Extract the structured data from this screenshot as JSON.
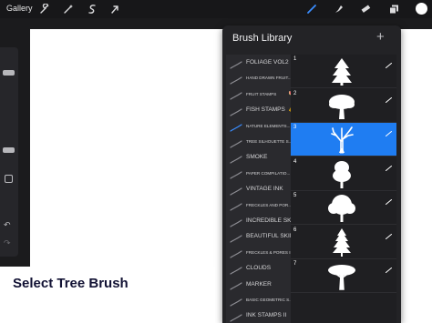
{
  "topbar": {
    "gallery_label": "Gallery",
    "tools": [
      "wrench-icon",
      "magic-wand-icon",
      "selection-s-icon",
      "arrow-cursor-icon"
    ],
    "right_tools": [
      "brush-icon",
      "smudge-icon",
      "eraser-icon",
      "layers-icon"
    ],
    "active_color": "#ffffff",
    "accent": "#3a8dff"
  },
  "panel": {
    "title": "Brush Library",
    "add_label": "+",
    "categories": [
      {
        "label": "FOLIAGE VOL2",
        "size": "big"
      },
      {
        "label": "HAND DRAWN FRUIT...",
        "size": "small"
      },
      {
        "label": "FRUIT STAMPS",
        "size": "small",
        "badge": "🍉"
      },
      {
        "label": "FISH STAMPS",
        "size": "big",
        "badge": "🐠"
      },
      {
        "label": "NATURE ELEMENTS...",
        "size": "small",
        "active": true
      },
      {
        "label": "TREE SILHOUETTE S...",
        "size": "small"
      },
      {
        "label": "SMOKE",
        "size": "big"
      },
      {
        "label": "PAPER COMPILATIO...",
        "size": "small"
      },
      {
        "label": "VINTAGE INK",
        "size": "big"
      },
      {
        "label": "FRECKLES AND POR...",
        "size": "small"
      },
      {
        "label": "INCREDIBLE SKIN",
        "size": "big"
      },
      {
        "label": "BEAUTIFUL SKIN",
        "size": "big"
      },
      {
        "label": "FRECKLES & PORES II",
        "size": "small"
      },
      {
        "label": "CLOUDS",
        "size": "big"
      },
      {
        "label": "MARKER",
        "size": "big"
      },
      {
        "label": "BASIC GEOMETRIC S...",
        "size": "small"
      },
      {
        "label": "INK STAMPS II",
        "size": "big"
      }
    ],
    "brushes": [
      {
        "number": "1",
        "icon": "pine-tree-icon"
      },
      {
        "number": "2",
        "icon": "broad-tree-icon"
      },
      {
        "number": "3",
        "icon": "bare-tree-icon",
        "selected": true
      },
      {
        "number": "4",
        "icon": "bushy-tree-icon"
      },
      {
        "number": "5",
        "icon": "round-tree-icon"
      },
      {
        "number": "6",
        "icon": "spruce-tree-icon"
      },
      {
        "number": "7",
        "icon": "acacia-tree-icon"
      }
    ],
    "selected_color": "#1f7df2"
  },
  "caption": {
    "text": "Select Tree Brush"
  }
}
